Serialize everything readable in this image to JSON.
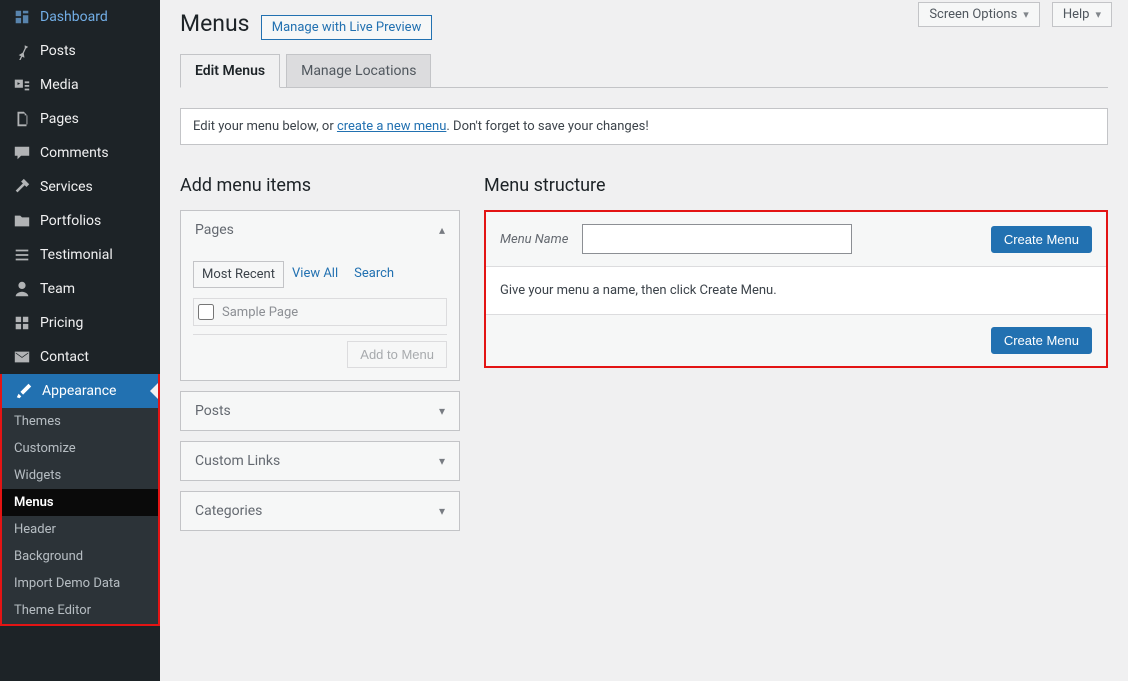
{
  "topControls": {
    "screenOptions": "Screen Options",
    "help": "Help"
  },
  "sidebar": {
    "items": [
      {
        "label": "Dashboard",
        "icon": "dashboard"
      },
      {
        "label": "Posts",
        "icon": "pin"
      },
      {
        "label": "Media",
        "icon": "media"
      },
      {
        "label": "Pages",
        "icon": "pages"
      },
      {
        "label": "Comments",
        "icon": "comment"
      },
      {
        "label": "Services",
        "icon": "hammer"
      },
      {
        "label": "Portfolios",
        "icon": "folder"
      },
      {
        "label": "Testimonial",
        "icon": "list"
      },
      {
        "label": "Team",
        "icon": "person"
      },
      {
        "label": "Pricing",
        "icon": "grid"
      },
      {
        "label": "Contact",
        "icon": "mail"
      },
      {
        "label": "Appearance",
        "icon": "brush",
        "active": true
      }
    ],
    "sub": [
      {
        "label": "Themes"
      },
      {
        "label": "Customize"
      },
      {
        "label": "Widgets"
      },
      {
        "label": "Menus",
        "current": true
      },
      {
        "label": "Header"
      },
      {
        "label": "Background"
      },
      {
        "label": "Import Demo Data"
      },
      {
        "label": "Theme Editor"
      }
    ]
  },
  "page": {
    "title": "Menus",
    "titleAction": "Manage with Live Preview",
    "tabs": {
      "edit": "Edit Menus",
      "locations": "Manage Locations"
    },
    "noticePre": "Edit your menu below, or ",
    "noticeLink": "create a new menu",
    "noticePost": ". Don't forget to save your changes!"
  },
  "left": {
    "title": "Add menu items",
    "pages": {
      "header": "Pages",
      "tabs": {
        "recent": "Most Recent",
        "viewAll": "View All",
        "search": "Search"
      },
      "item": "Sample Page",
      "addBtn": "Add to Menu"
    },
    "sections": {
      "posts": "Posts",
      "links": "Custom Links",
      "categories": "Categories"
    }
  },
  "right": {
    "title": "Menu structure",
    "menuNameLabel": "Menu Name",
    "menuNameValue": "",
    "createBtn": "Create Menu",
    "bodyText": "Give your menu a name, then click Create Menu."
  }
}
